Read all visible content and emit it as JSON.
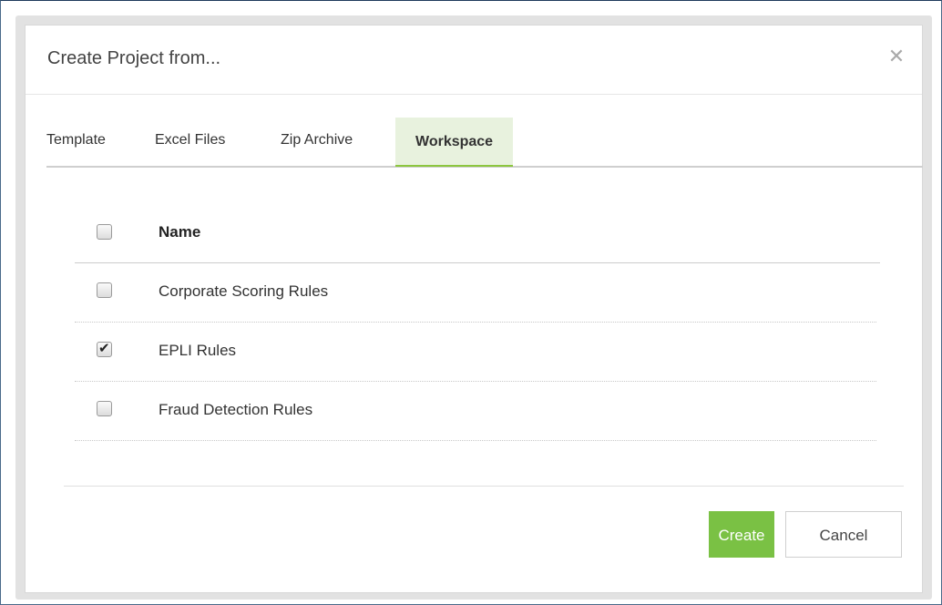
{
  "dialog": {
    "title": "Create Project from...",
    "close_icon": "close-icon"
  },
  "tabs": [
    {
      "label": "Template",
      "active": false
    },
    {
      "label": "Excel Files",
      "active": false
    },
    {
      "label": "Zip Archive",
      "active": false
    },
    {
      "label": "Workspace",
      "active": true
    }
  ],
  "table": {
    "header": {
      "label": "Name",
      "checked": false
    },
    "rows": [
      {
        "name": "Corporate Scoring Rules",
        "checked": false
      },
      {
        "name": "EPLI Rules",
        "checked": true
      },
      {
        "name": "Fraud Detection Rules",
        "checked": false
      }
    ]
  },
  "buttons": {
    "create_label": "Create",
    "cancel_label": "Cancel"
  },
  "colors": {
    "accent": "#7ac144",
    "active_tab_bg": "#e8f2de"
  }
}
